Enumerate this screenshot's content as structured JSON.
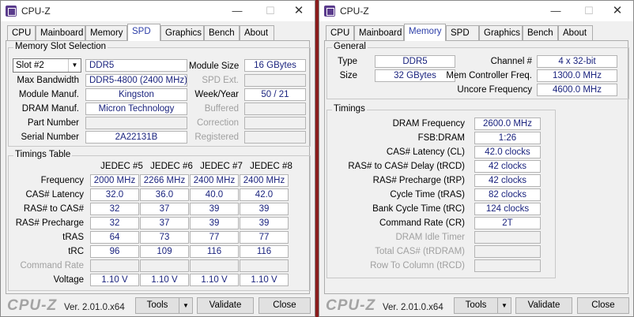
{
  "app_title": "CPU-Z",
  "window_controls": {
    "minimize": "—",
    "maximize": "☐",
    "close": "✕"
  },
  "tabs": [
    "CPU",
    "Mainboard",
    "Memory",
    "SPD",
    "Graphics",
    "Bench",
    "About"
  ],
  "left": {
    "active_tab": "SPD",
    "slot_group_title": "Memory Slot Selection",
    "slot_select": "Slot #2",
    "type_value": "DDR5",
    "labels": {
      "max_bandwidth": "Max Bandwidth",
      "module_manuf": "Module Manuf.",
      "dram_manuf": "DRAM Manuf.",
      "part_number": "Part Number",
      "serial_number": "Serial Number",
      "module_size": "Module Size",
      "spd_ext": "SPD Ext.",
      "week_year": "Week/Year",
      "buffered": "Buffered",
      "correction": "Correction",
      "registered": "Registered"
    },
    "values": {
      "max_bandwidth": "DDR5-4800 (2400 MHz)",
      "module_manuf": "Kingston",
      "dram_manuf": "Micron Technology",
      "part_number": "",
      "serial_number": "2A22131B",
      "module_size": "16 GBytes",
      "spd_ext": "",
      "week_year": "50 / 21",
      "buffered": "",
      "correction": "",
      "registered": ""
    },
    "timings_group_title": "Timings Table",
    "timings_columns": [
      "JEDEC #5",
      "JEDEC #6",
      "JEDEC #7",
      "JEDEC #8"
    ],
    "timings_rows": [
      {
        "label": "Frequency",
        "values": [
          "2000 MHz",
          "2266 MHz",
          "2400 MHz",
          "2400 MHz"
        ]
      },
      {
        "label": "CAS# Latency",
        "values": [
          "32.0",
          "36.0",
          "40.0",
          "42.0"
        ]
      },
      {
        "label": "RAS# to CAS#",
        "values": [
          "32",
          "37",
          "39",
          "39"
        ]
      },
      {
        "label": "RAS# Precharge",
        "values": [
          "32",
          "37",
          "39",
          "39"
        ]
      },
      {
        "label": "tRAS",
        "values": [
          "64",
          "73",
          "77",
          "77"
        ]
      },
      {
        "label": "tRC",
        "values": [
          "96",
          "109",
          "116",
          "116"
        ]
      },
      {
        "label": "Command Rate",
        "values": [
          "",
          "",
          "",
          ""
        ]
      },
      {
        "label": "Voltage",
        "values": [
          "1.10 V",
          "1.10 V",
          "1.10 V",
          "1.10 V"
        ]
      }
    ]
  },
  "right": {
    "active_tab": "Memory",
    "general_title": "General",
    "general": {
      "type_label": "Type",
      "type_value": "DDR5",
      "size_label": "Size",
      "size_value": "32 GBytes",
      "channel_label": "Channel #",
      "channel_value": "4 x 32-bit",
      "mcf_label": "Mem Controller Freq.",
      "mcf_value": "1300.0 MHz",
      "uncore_label": "Uncore Frequency",
      "uncore_value": "4600.0 MHz"
    },
    "timings_title": "Timings",
    "timings": [
      {
        "label": "DRAM Frequency",
        "value": "2600.0 MHz"
      },
      {
        "label": "FSB:DRAM",
        "value": "1:26"
      },
      {
        "label": "CAS# Latency (CL)",
        "value": "42.0 clocks"
      },
      {
        "label": "RAS# to CAS# Delay (tRCD)",
        "value": "42 clocks"
      },
      {
        "label": "RAS# Precharge (tRP)",
        "value": "42 clocks"
      },
      {
        "label": "Cycle Time (tRAS)",
        "value": "82 clocks"
      },
      {
        "label": "Bank Cycle Time (tRC)",
        "value": "124 clocks"
      },
      {
        "label": "Command Rate (CR)",
        "value": "2T"
      },
      {
        "label": "DRAM Idle Timer",
        "value": ""
      },
      {
        "label": "Total CAS# (tRDRAM)",
        "value": ""
      },
      {
        "label": "Row To Column (tRCD)",
        "value": ""
      }
    ]
  },
  "bottom": {
    "logo": "CPU-Z",
    "version": "Ver. 2.01.0.x64",
    "tools": "Tools",
    "dropdown_arrow": "▼",
    "validate": "Validate",
    "close": "Close"
  }
}
